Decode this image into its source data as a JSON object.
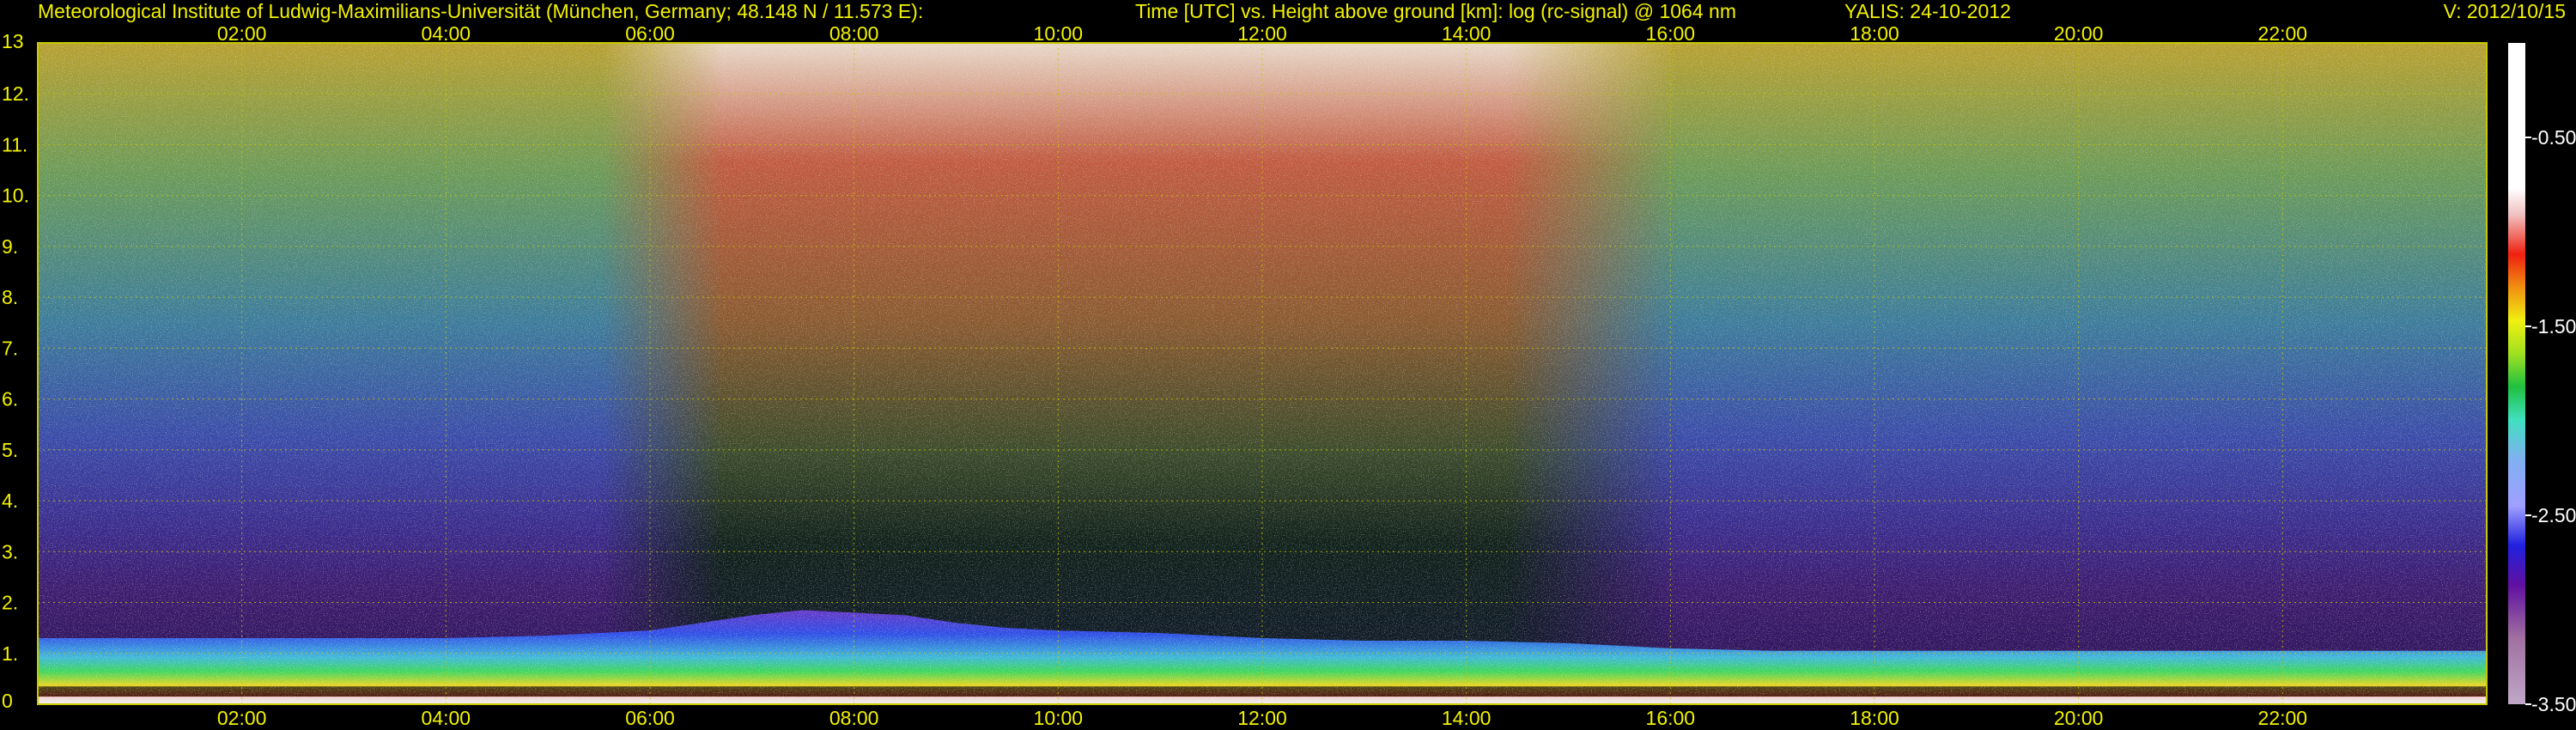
{
  "header": {
    "institute": "Meteorological Institute of Ludwig-Maximilians-Universität (München, Germany; 48.148 N / 11.573 E):",
    "plot_description": "Time [UTC] vs. Height above ground [km]: log (rc-signal) @ 1064 nm",
    "instrument_date": "YALIS: 24-10-2012",
    "version": "V: 2012/10/15"
  },
  "colors": {
    "header_text": "#f2f200",
    "grid": "#c8c800",
    "background": "#000000"
  },
  "chart_data": {
    "type": "heatmap",
    "title": "Time [UTC] vs. Height above ground [km]: log (rc-signal) @ 1064 nm",
    "x_axis": {
      "unit": "hours UTC",
      "range": [
        0,
        24
      ],
      "ticks": [
        2,
        4,
        6,
        8,
        10,
        12,
        14,
        16,
        18,
        20,
        22
      ],
      "tick_labels": [
        "02:00",
        "04:00",
        "06:00",
        "08:00",
        "10:00",
        "12:00",
        "14:00",
        "16:00",
        "18:00",
        "20:00",
        "22:00"
      ]
    },
    "y_axis": {
      "unit": "km",
      "range": [
        0,
        13
      ],
      "ticks": [
        0,
        1,
        2,
        3,
        4,
        5,
        6,
        7,
        8,
        9,
        10,
        11,
        12,
        13
      ],
      "tick_labels": [
        "0",
        "1.",
        "2.",
        "3.",
        "4.",
        "5.",
        "6.",
        "7.",
        "8.",
        "9.",
        "10.",
        "11.",
        "12.",
        "13"
      ]
    },
    "grid": true,
    "colorbar": {
      "range": [
        -3.5,
        0
      ],
      "ticks": [
        -0.5,
        -1.5,
        -2.5,
        -3.5
      ],
      "tick_labels": [
        "-0.50",
        "-1.50",
        "-2.50",
        "-3.50"
      ]
    },
    "boundary_layer": {
      "time": [
        0,
        1,
        2,
        3,
        4,
        5,
        6,
        6.5,
        7,
        7.5,
        8,
        8.5,
        9,
        9.5,
        10,
        11,
        12,
        13,
        14,
        15,
        16,
        17,
        18,
        19,
        20,
        21,
        22,
        23,
        24
      ],
      "top_km": [
        1.3,
        1.3,
        1.3,
        1.3,
        1.3,
        1.35,
        1.45,
        1.6,
        1.75,
        1.85,
        1.8,
        1.75,
        1.6,
        1.5,
        1.45,
        1.4,
        1.3,
        1.25,
        1.25,
        1.2,
        1.1,
        1.05,
        1.05,
        1.05,
        1.05,
        1.05,
        1.05,
        1.05,
        1.05
      ]
    }
  }
}
